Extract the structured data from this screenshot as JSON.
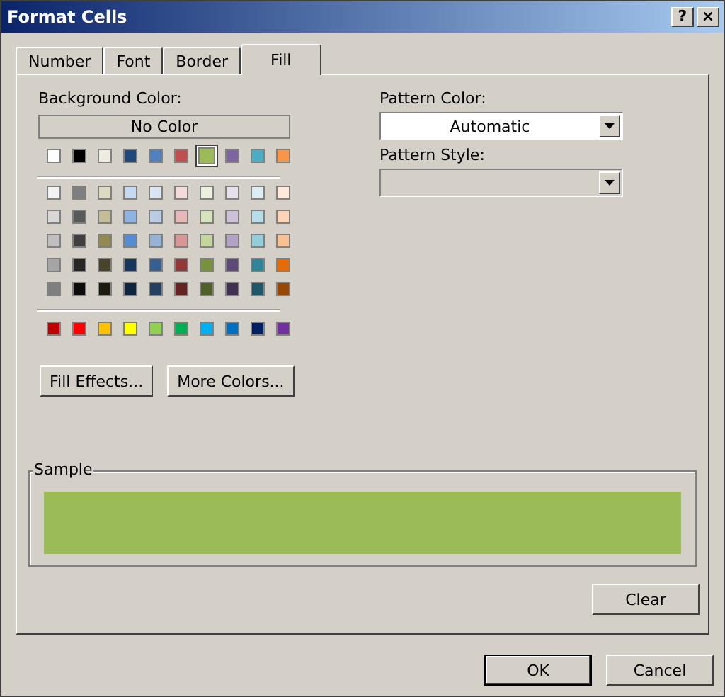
{
  "window": {
    "title": "Format Cells",
    "help_button": "?",
    "close_button": "×"
  },
  "tabs": [
    {
      "label": "Number",
      "selected": false
    },
    {
      "label": "Font",
      "selected": false
    },
    {
      "label": "Border",
      "selected": false
    },
    {
      "label": "Fill",
      "selected": true
    }
  ],
  "background_color": {
    "label": "Background Color:",
    "no_color_button": "No Color",
    "theme_colors": [
      {
        "color": "#ffffff",
        "selected": false
      },
      {
        "color": "#000000",
        "selected": false
      },
      {
        "color": "#eeece1",
        "selected": false
      },
      {
        "color": "#1f497d",
        "selected": false
      },
      {
        "color": "#4f81bd",
        "selected": false
      },
      {
        "color": "#c0504d",
        "selected": false
      },
      {
        "color": "#9bbb59",
        "selected": true
      },
      {
        "color": "#8064a2",
        "selected": false
      },
      {
        "color": "#4bacc6",
        "selected": false
      },
      {
        "color": "#f79646",
        "selected": false
      }
    ],
    "tint_rows": [
      [
        {
          "color": "#f2f2f2",
          "selected": false
        },
        {
          "color": "#7f7f7f",
          "selected": false
        },
        {
          "color": "#ddd9c3",
          "selected": false
        },
        {
          "color": "#c6d9f0",
          "selected": false
        },
        {
          "color": "#dbe5f1",
          "selected": false
        },
        {
          "color": "#f2dcdb",
          "selected": false
        },
        {
          "color": "#ebf1dd",
          "selected": false
        },
        {
          "color": "#e5e0ec",
          "selected": false
        },
        {
          "color": "#dbeef3",
          "selected": false
        },
        {
          "color": "#fdeada",
          "selected": false
        }
      ],
      [
        {
          "color": "#d8d8d8",
          "selected": false
        },
        {
          "color": "#595959",
          "selected": false
        },
        {
          "color": "#c4bd97",
          "selected": false
        },
        {
          "color": "#8db3e2",
          "selected": false
        },
        {
          "color": "#b8cce4",
          "selected": false
        },
        {
          "color": "#e5b9b7",
          "selected": false
        },
        {
          "color": "#d7e3bc",
          "selected": false
        },
        {
          "color": "#ccc1d9",
          "selected": false
        },
        {
          "color": "#b7dde8",
          "selected": false
        },
        {
          "color": "#fbd5b5",
          "selected": false
        }
      ],
      [
        {
          "color": "#bfbfbf",
          "selected": false
        },
        {
          "color": "#3f3f3f",
          "selected": false
        },
        {
          "color": "#938953",
          "selected": false
        },
        {
          "color": "#548dd4",
          "selected": false
        },
        {
          "color": "#95b3d7",
          "selected": false
        },
        {
          "color": "#d99694",
          "selected": false
        },
        {
          "color": "#c3d69b",
          "selected": false
        },
        {
          "color": "#b2a2c7",
          "selected": false
        },
        {
          "color": "#92cddc",
          "selected": false
        },
        {
          "color": "#fac08f",
          "selected": false
        }
      ],
      [
        {
          "color": "#a5a5a5",
          "selected": false
        },
        {
          "color": "#262626",
          "selected": false
        },
        {
          "color": "#494429",
          "selected": false
        },
        {
          "color": "#17365d",
          "selected": false
        },
        {
          "color": "#366092",
          "selected": false
        },
        {
          "color": "#953734",
          "selected": false
        },
        {
          "color": "#76923c",
          "selected": false
        },
        {
          "color": "#5f497a",
          "selected": false
        },
        {
          "color": "#31859b",
          "selected": false
        },
        {
          "color": "#e36c09",
          "selected": false
        }
      ],
      [
        {
          "color": "#7f7f7f",
          "selected": false
        },
        {
          "color": "#0c0c0c",
          "selected": false
        },
        {
          "color": "#1d1b10",
          "selected": false
        },
        {
          "color": "#0f243e",
          "selected": false
        },
        {
          "color": "#244061",
          "selected": false
        },
        {
          "color": "#632423",
          "selected": false
        },
        {
          "color": "#4f6128",
          "selected": false
        },
        {
          "color": "#3f3151",
          "selected": false
        },
        {
          "color": "#205867",
          "selected": false
        },
        {
          "color": "#974806",
          "selected": false
        }
      ]
    ],
    "standard_colors": [
      {
        "color": "#c00000",
        "selected": false
      },
      {
        "color": "#ff0000",
        "selected": false
      },
      {
        "color": "#ffc000",
        "selected": false
      },
      {
        "color": "#ffff00",
        "selected": false
      },
      {
        "color": "#92d050",
        "selected": false
      },
      {
        "color": "#00b050",
        "selected": false
      },
      {
        "color": "#00b0f0",
        "selected": false
      },
      {
        "color": "#0070c0",
        "selected": false
      },
      {
        "color": "#002060",
        "selected": false
      },
      {
        "color": "#7030a0",
        "selected": false
      }
    ],
    "buttons": [
      "Fill Effects...",
      "More Colors..."
    ]
  },
  "pattern_color": {
    "label": "Pattern Color:",
    "value": "Automatic"
  },
  "pattern_style": {
    "label": "Pattern Style:"
  },
  "sample": {
    "label": "Sample",
    "color": "#9bbb59"
  },
  "clear_button": "Clear",
  "buttons": [
    "OK",
    "Cancel"
  ]
}
